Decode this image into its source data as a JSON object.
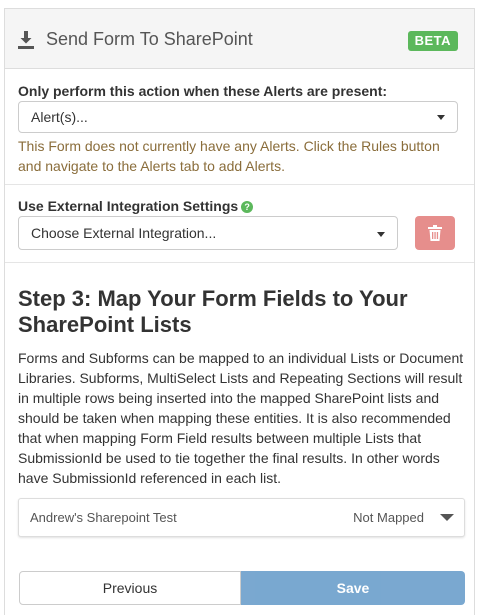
{
  "header": {
    "title": "Send Form To SharePoint",
    "badge": "BETA"
  },
  "alerts": {
    "label": "Only perform this action when these Alerts are present:",
    "selected": "Alert(s)...",
    "warning": "This Form does not currently have any Alerts. Click the Rules button and navigate to the Alerts tab to add Alerts."
  },
  "integration": {
    "label": "Use External Integration Settings",
    "help_icon": "question-circle-icon",
    "selected": "Choose External Integration...",
    "delete_icon": "trash-icon"
  },
  "step": {
    "title": "Step 3: Map Your Form Fields to Your SharePoint Lists",
    "description": "Forms and Subforms can be mapped to an individual Lists or Document Libraries. Subforms, MultiSelect Lists and Repeating Sections will result in multiple rows being inserted into the mapped SharePoint lists and should be taken when mapping these entities. It is also recommended that when mapping Form Field results between multiple Lists that SubmissionId be used to tie together the final results. In other words have SubmissionId referenced in each list."
  },
  "mapping": {
    "items": [
      {
        "name": "Andrew's Sharepoint Test",
        "status": "Not Mapped"
      }
    ]
  },
  "footer": {
    "previous_label": "Previous",
    "save_label": "Save"
  },
  "colors": {
    "beta_badge": "#5cb85c",
    "warning_text": "#8a6d3b",
    "delete_button": "#d9534f",
    "save_button": "#337ab7"
  }
}
